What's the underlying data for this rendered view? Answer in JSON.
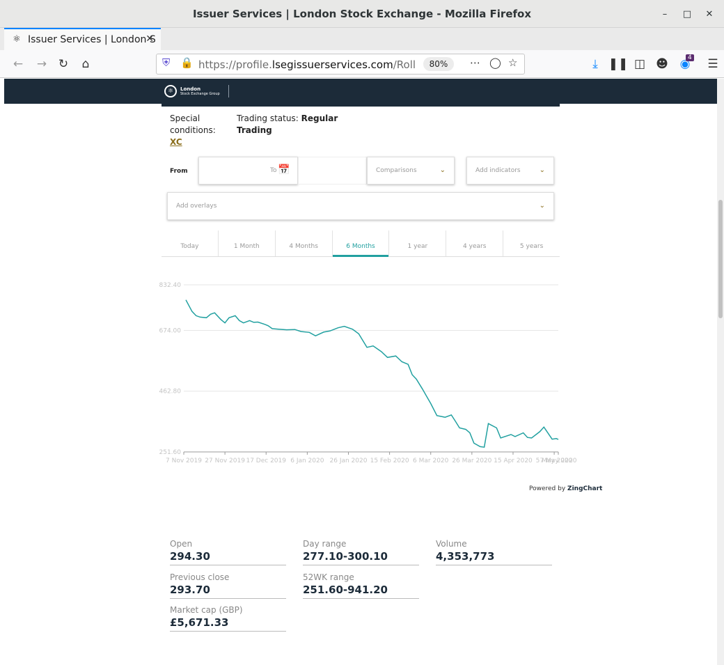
{
  "browser": {
    "window_title": "Issuer Services | London Stock Exchange - Mozilla Firefox",
    "tab_title": "Issuer Services | London S",
    "url_prefix": "https://profile.",
    "url_domain": "lsegissuerservices.com",
    "url_suffix": "/Roll",
    "zoom": "80%",
    "notification_count": "4"
  },
  "header": {
    "logo_line1": "London",
    "logo_line2": "Stock Exchange Group"
  },
  "info": {
    "special_conditions_label": "Special conditions:",
    "special_conditions_value": "XC",
    "trading_status_label": "Trading status:",
    "trading_status_value_1": "Regular",
    "trading_status_value_2": "Trading"
  },
  "controls": {
    "from_label": "From",
    "to_label": "To",
    "comparisons": "Comparisons",
    "add_indicators": "Add indicators",
    "add_overlays": "Add overlays"
  },
  "periods": [
    "Today",
    "1 Month",
    "4 Months",
    "6 Months",
    "1 year",
    "4 years",
    "5 years"
  ],
  "active_period": "6 Months",
  "powered_by": "Powered by",
  "powered_brand": "ZingChart",
  "chart_data": {
    "type": "line",
    "title": "",
    "xlabel": "",
    "ylabel": "",
    "y_ticks": [
      "832.40",
      "674.00",
      "462.80",
      "251.60"
    ],
    "ylim": [
      251.6,
      832.4
    ],
    "x_ticks": [
      "7 Nov 2019",
      "27 Nov 2019",
      "17 Dec 2019",
      "6 Jan 2020",
      "26 Jan 2020",
      "15 Feb 2020",
      "6 Mar 2020",
      "26 Mar 2020",
      "15 Apr 2020",
      "5 May 2020",
      "7 May 2020"
    ],
    "grid": true,
    "color": "#21a0a0",
    "series": [
      {
        "x": [
          "2019-11-08",
          "2019-11-11",
          "2019-11-13",
          "2019-11-15",
          "2019-11-18",
          "2019-11-20",
          "2019-11-22",
          "2019-11-25",
          "2019-11-27",
          "2019-11-29",
          "2019-12-02",
          "2019-12-04",
          "2019-12-06",
          "2019-12-09",
          "2019-12-11",
          "2019-12-13",
          "2019-12-16",
          "2019-12-18",
          "2019-12-20",
          "2019-12-23",
          "2019-12-27",
          "2019-12-31",
          "2020-01-03",
          "2020-01-07",
          "2020-01-10",
          "2020-01-14",
          "2020-01-17",
          "2020-01-21",
          "2020-01-24",
          "2020-01-28",
          "2020-01-31",
          "2020-02-04",
          "2020-02-07",
          "2020-02-11",
          "2020-02-14",
          "2020-02-18",
          "2020-02-21",
          "2020-02-24",
          "2020-02-26",
          "2020-02-28",
          "2020-03-02",
          "2020-03-04",
          "2020-03-06",
          "2020-03-09",
          "2020-03-11",
          "2020-03-13",
          "2020-03-16",
          "2020-03-18",
          "2020-03-20",
          "2020-03-23",
          "2020-03-25",
          "2020-03-27",
          "2020-03-30",
          "2020-04-01",
          "2020-04-03",
          "2020-04-07",
          "2020-04-09",
          "2020-04-14",
          "2020-04-16",
          "2020-04-20",
          "2020-04-22",
          "2020-04-24",
          "2020-04-28",
          "2020-04-30",
          "2020-05-04",
          "2020-05-06",
          "2020-05-07"
        ],
        "y": [
          780,
          740,
          725,
          720,
          718,
          730,
          735,
          712,
          700,
          718,
          725,
          708,
          700,
          708,
          702,
          703,
          696,
          690,
          680,
          678,
          676,
          677,
          670,
          667,
          655,
          668,
          672,
          683,
          688,
          678,
          662,
          615,
          620,
          600,
          580,
          585,
          565,
          556,
          520,
          505,
          470,
          445,
          420,
          378,
          375,
          372,
          380,
          358,
          335,
          330,
          318,
          282,
          270,
          268,
          350,
          335,
          300,
          312,
          305,
          318,
          302,
          300,
          322,
          338,
          296,
          298,
          295
        ]
      }
    ]
  },
  "stats": [
    {
      "label": "Open",
      "value": "294.30"
    },
    {
      "label": "Day range",
      "value": "277.10-300.10"
    },
    {
      "label": "Volume",
      "value": "4,353,773"
    },
    {
      "label": "Previous close",
      "value": "293.70"
    },
    {
      "label": "52WK range",
      "value": "251.60-941.20"
    },
    {
      "label": "Market cap (GBP)",
      "value": "£5,671.33"
    }
  ]
}
